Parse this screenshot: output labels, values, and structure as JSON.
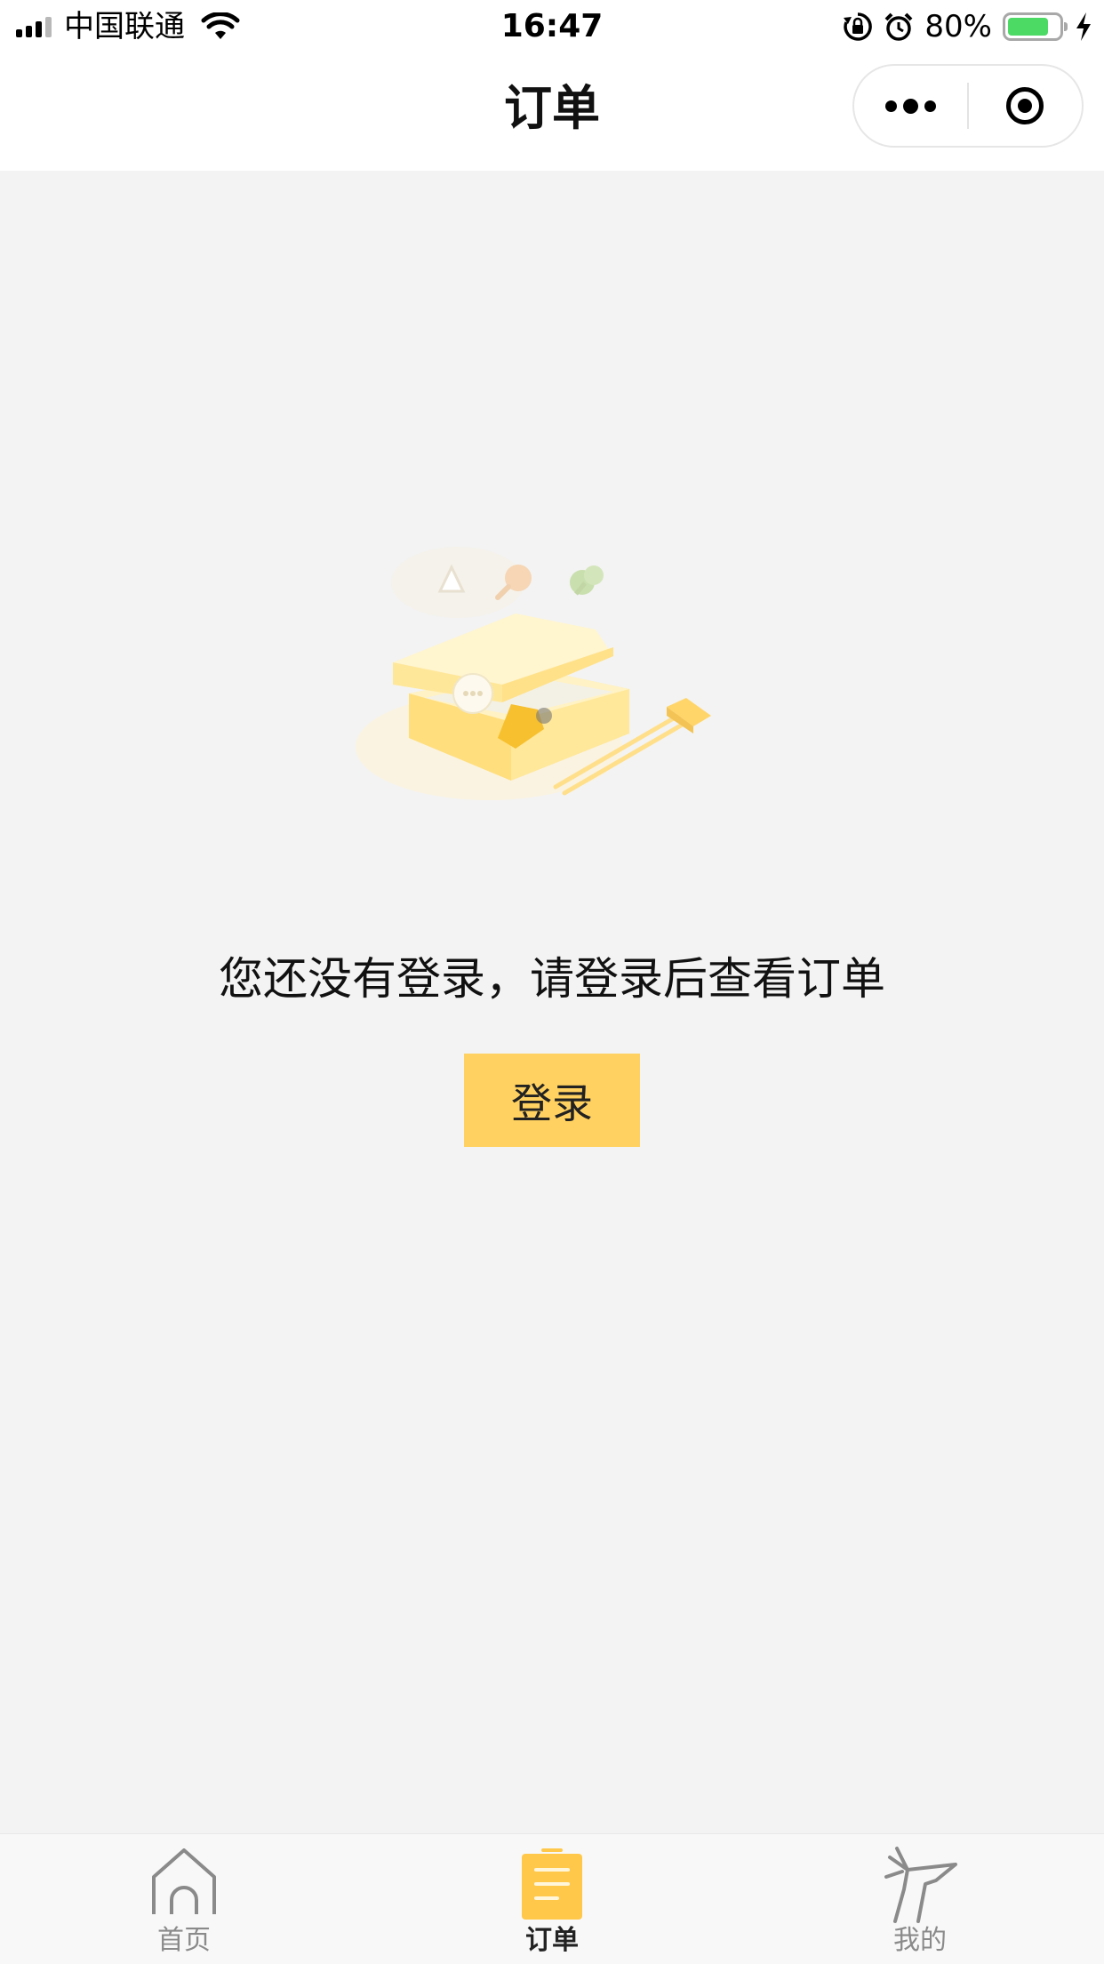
{
  "status_bar": {
    "carrier": "中国联通",
    "time": "16:47",
    "battery_percent": "80%",
    "battery_level": 0.8,
    "icons": [
      "signal-icon",
      "wifi-icon",
      "rotation-lock-icon",
      "alarm-icon",
      "battery-icon",
      "charging-icon"
    ]
  },
  "nav": {
    "title": "订单",
    "capsule": [
      "more-icon",
      "close-target-icon"
    ]
  },
  "empty_state": {
    "illustration": "food-box-illustration",
    "message": "您还没有登录，请登录后查看订单",
    "login_label": "登录"
  },
  "tabs": [
    {
      "label": "首页",
      "icon": "home-icon",
      "active": false
    },
    {
      "label": "订单",
      "icon": "order-icon",
      "active": true
    },
    {
      "label": "我的",
      "icon": "deer-icon",
      "active": false
    }
  ],
  "colors": {
    "accent": "#ffd160",
    "background": "#f3f3f3",
    "battery": "#4cd964"
  }
}
